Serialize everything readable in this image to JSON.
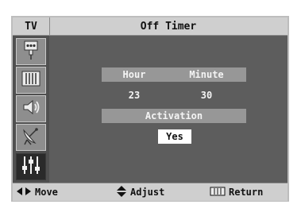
{
  "header": {
    "menu_tab": "TV",
    "title": "Off Timer"
  },
  "sidebar": {
    "items": [
      {
        "icon": "input-plug-icon",
        "active": false
      },
      {
        "icon": "picture-bars-icon",
        "active": false
      },
      {
        "icon": "speaker-sound-icon",
        "active": false
      },
      {
        "icon": "satellite-dish-icon",
        "active": false
      },
      {
        "icon": "sliders-setup-icon",
        "active": true
      }
    ]
  },
  "off_timer": {
    "hour_label": "Hour",
    "minute_label": "Minute",
    "hour_value": "23",
    "minute_value": "30",
    "activation_label": "Activation",
    "activation_value": "Yes"
  },
  "footer": {
    "move": "Move",
    "adjust": "Adjust",
    "return": "Return"
  },
  "colors": {
    "panel": "#5d5d5d",
    "bar": "#cfcfcf",
    "field": "#979797",
    "selected": "#ffffff"
  }
}
